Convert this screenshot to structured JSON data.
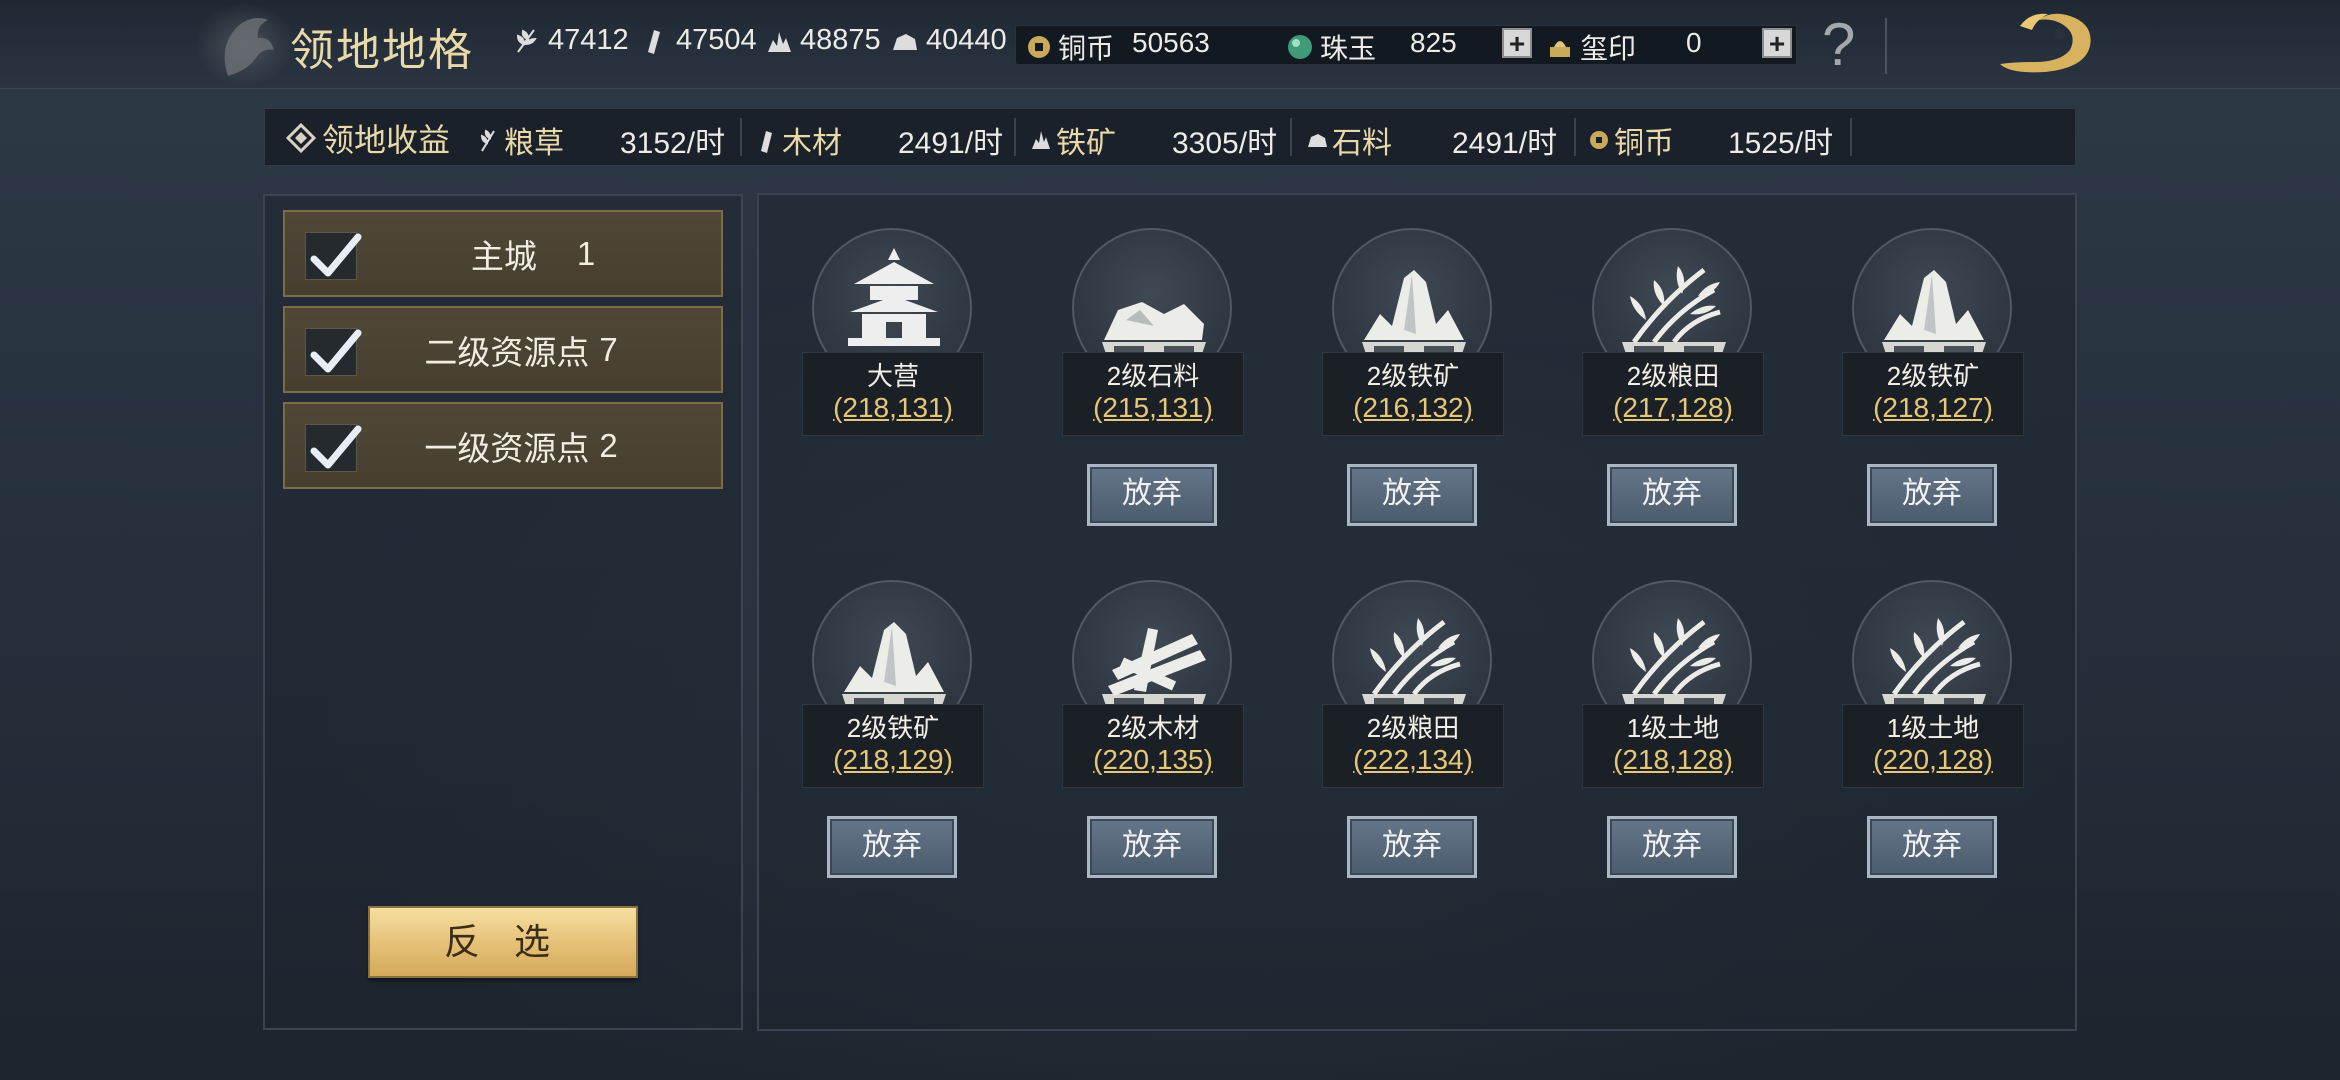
{
  "header": {
    "title": "领地地格",
    "resources": [
      {
        "icon": "grain-icon",
        "value": "47412"
      },
      {
        "icon": "wood-icon",
        "value": "47504"
      },
      {
        "icon": "iron-icon",
        "value": "48875"
      },
      {
        "icon": "stone-icon",
        "value": "40440"
      }
    ],
    "copper": {
      "label": "铜币",
      "value": "50563"
    },
    "jade": {
      "label": "珠玉",
      "value": "825"
    },
    "seal": {
      "label": "玺印",
      "value": "0"
    },
    "plus": "+",
    "help": "?"
  },
  "income": {
    "title": "领地收益",
    "items": [
      {
        "label": "粮草",
        "value": "3152/时"
      },
      {
        "label": "木材",
        "value": "2491/时"
      },
      {
        "label": "铁矿",
        "value": "3305/时"
      },
      {
        "label": "石料",
        "value": "2491/时"
      },
      {
        "label": "铜币",
        "value": "1525/时"
      }
    ]
  },
  "filters": [
    {
      "label": "主城",
      "count": "1",
      "checked": true
    },
    {
      "label": "二级资源点",
      "count": "7",
      "checked": true
    },
    {
      "label": "一级资源点",
      "count": "2",
      "checked": true
    }
  ],
  "invert_label": "反 选",
  "tiles": [
    {
      "name": "大营",
      "coord": "(218,131)",
      "type": "camp",
      "abandon": ""
    },
    {
      "name": "2级石料",
      "coord": "(215,131)",
      "type": "stone",
      "abandon": "放弃"
    },
    {
      "name": "2级铁矿",
      "coord": "(216,132)",
      "type": "iron",
      "abandon": "放弃"
    },
    {
      "name": "2级粮田",
      "coord": "(217,128)",
      "type": "grain",
      "abandon": "放弃"
    },
    {
      "name": "2级铁矿",
      "coord": "(218,127)",
      "type": "iron",
      "abandon": "放弃"
    },
    {
      "name": "2级铁矿",
      "coord": "(218,129)",
      "type": "iron",
      "abandon": "放弃"
    },
    {
      "name": "2级木材",
      "coord": "(220,135)",
      "type": "wood",
      "abandon": "放弃"
    },
    {
      "name": "2级粮田",
      "coord": "(222,134)",
      "type": "grain",
      "abandon": "放弃"
    },
    {
      "name": "1级土地",
      "coord": "(218,128)",
      "type": "grain",
      "abandon": "放弃"
    },
    {
      "name": "1级土地",
      "coord": "(220,128)",
      "type": "grain",
      "abandon": "放弃"
    }
  ],
  "colors": {
    "accent_gold": "#e6c777",
    "title_gold": "#e9d9a8",
    "panel_border": "#3b4552",
    "button_blue": "#5a6a7e"
  }
}
